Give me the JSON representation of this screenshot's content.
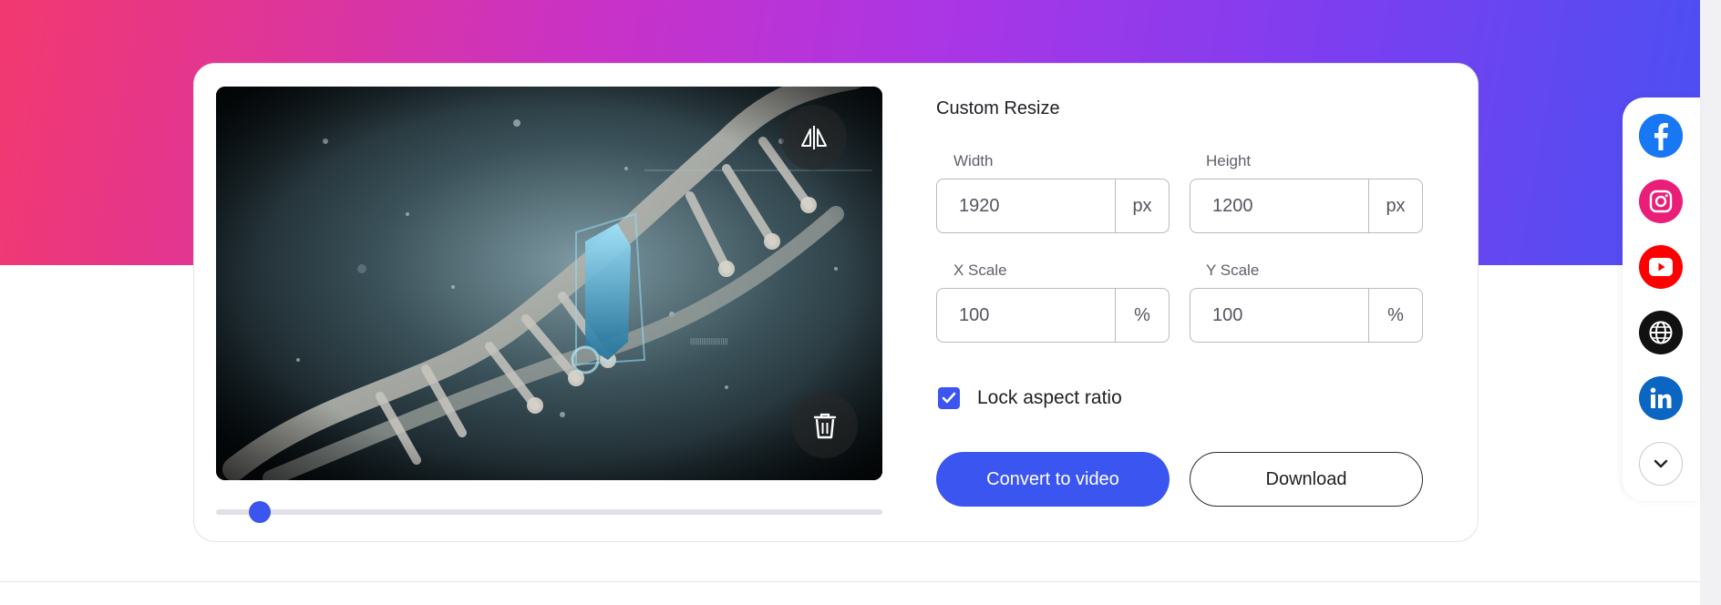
{
  "colors": {
    "accent": "#3a55f0",
    "gradient_start": "#f2386f",
    "gradient_mid": "#a936e6",
    "gradient_end": "#4a50f2"
  },
  "preview": {
    "image_description": "dna-helix-artwork",
    "mirror_icon": "flip-horizontal-icon",
    "delete_icon": "trash-icon",
    "zoom_fraction": 0.065
  },
  "resize": {
    "title": "Custom Resize",
    "width": {
      "label": "Width",
      "value": "1920",
      "unit": "px"
    },
    "height": {
      "label": "Height",
      "value": "1200",
      "unit": "px"
    },
    "x_scale": {
      "label": "X Scale",
      "value": "100",
      "unit": "%"
    },
    "y_scale": {
      "label": "Y Scale",
      "value": "100",
      "unit": "%"
    },
    "lock_aspect": {
      "label": "Lock aspect ratio",
      "checked": true
    }
  },
  "actions": {
    "convert_label": "Convert to video",
    "download_label": "Download"
  },
  "social": [
    {
      "name": "facebook",
      "icon": "facebook-icon",
      "color": "#1877f2"
    },
    {
      "name": "instagram",
      "icon": "instagram-icon",
      "color": "#e91e78"
    },
    {
      "name": "youtube",
      "icon": "youtube-icon",
      "color": "#ff0000"
    },
    {
      "name": "website",
      "icon": "globe-icon",
      "color": "#111111"
    },
    {
      "name": "linkedin",
      "icon": "linkedin-icon",
      "color": "#0a66c2"
    }
  ],
  "social_collapse_icon": "chevron-down-icon"
}
